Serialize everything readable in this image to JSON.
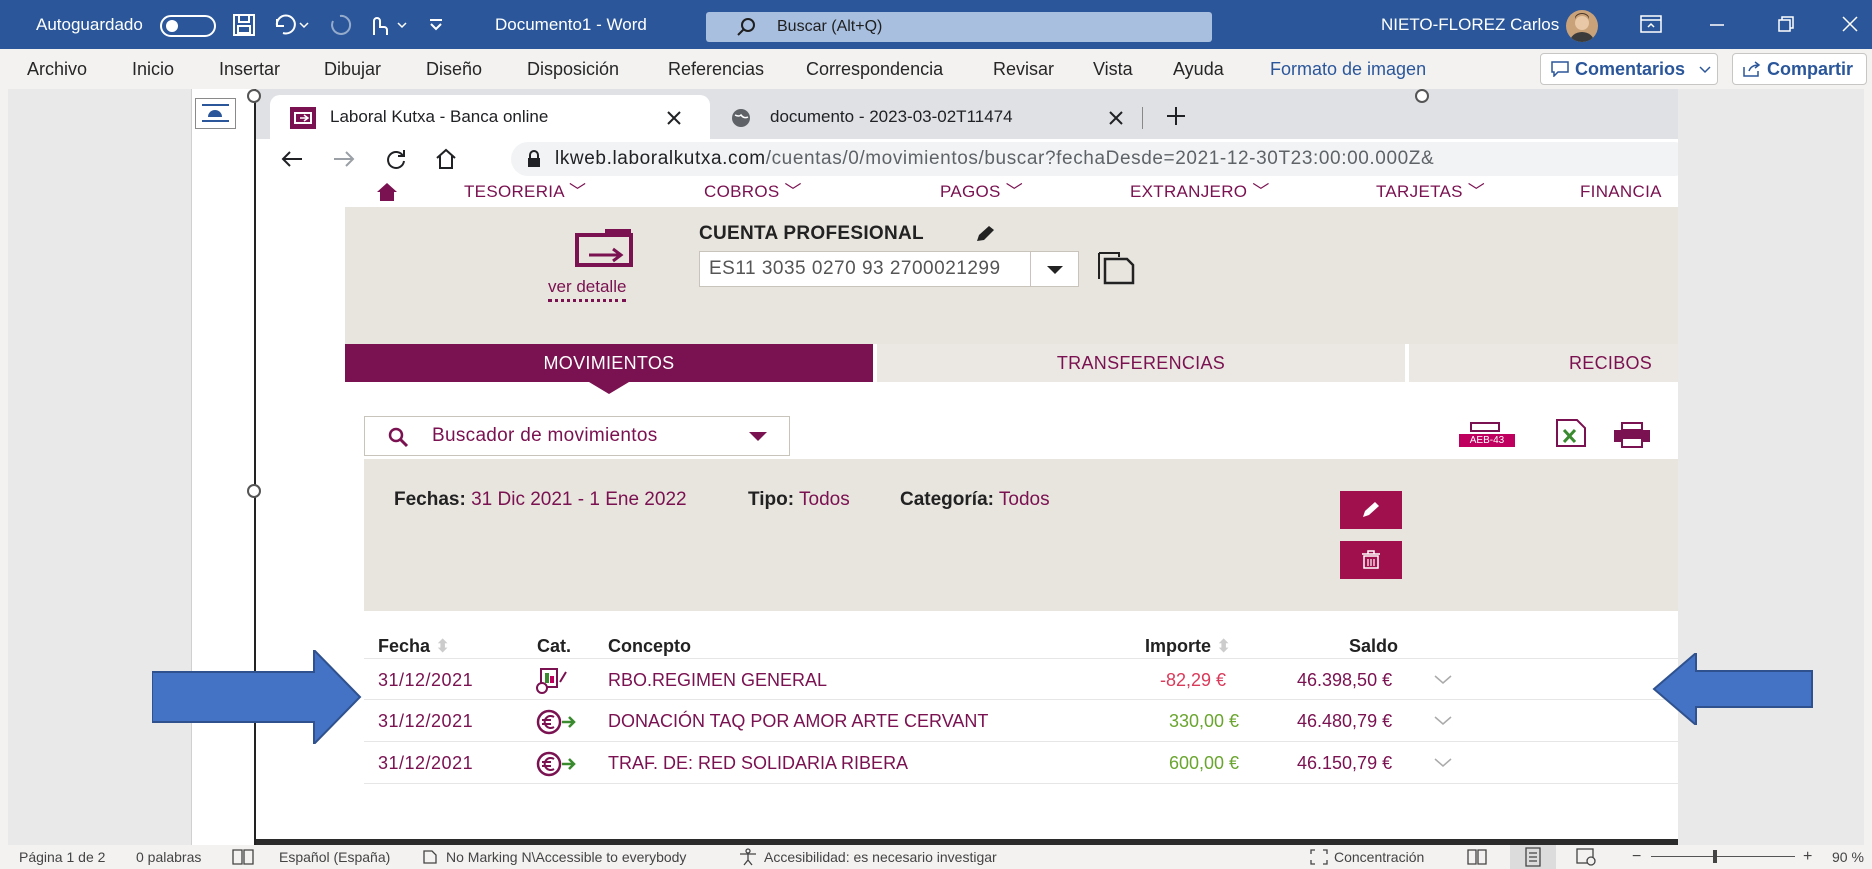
{
  "word": {
    "autosave_label": "Autoguardado",
    "doc_title": "Documento1  -  Word",
    "search_placeholder": "Buscar (Alt+Q)",
    "user_name": "NIETO-FLOREZ Carlos",
    "menu": [
      "Archivo",
      "Inicio",
      "Insertar",
      "Dibujar",
      "Diseño",
      "Disposición",
      "Referencias",
      "Correspondencia",
      "Revisar",
      "Vista",
      "Ayuda",
      "Formato de imagen"
    ],
    "comments_label": "Comentarios",
    "share_label": "Compartir",
    "accent": "#2b579a"
  },
  "browser": {
    "tab1": "Laboral Kutxa - Banca online",
    "tab2": "documento - 2023-03-02T11474",
    "url_domain": "lkweb.laboralkutxa.com",
    "url_path": "/cuentas/0/movimientos/buscar?fechaDesde=2021-12-30T23:00:00.000Z&"
  },
  "bank": {
    "brand_color": "#7a1150",
    "nav": [
      "TESORERIA",
      "COBROS",
      "PAGOS",
      "EXTRANJERO",
      "TARJETAS",
      "FINANCIA"
    ],
    "account_title": "CUENTA PROFESIONAL",
    "account_number": "ES11 3035 0270 93 2700021299",
    "ver_detalle": "ver detalle",
    "tabs": [
      "MOVIMIENTOS",
      "TRANSFERENCIAS",
      "RECIBOS"
    ],
    "search_label": "Buscador de movimientos",
    "aeb_label": "AEB-43",
    "filter": {
      "fechas_label": "Fechas:",
      "fechas_value": "31 Dic 2021 - 1 Ene 2022",
      "tipo_label": "Tipo:",
      "tipo_value": "Todos",
      "categoria_label": "Categoría:",
      "categoria_value": "Todos"
    },
    "table": {
      "headers": [
        "Fecha",
        "Cat.",
        "Concepto",
        "Importe",
        "Saldo"
      ],
      "rows": [
        {
          "fecha": "31/12/2021",
          "concepto": "RBO.REGIMEN GENERAL",
          "importe": "-82,29 €",
          "saldo": "46.398,50 €"
        },
        {
          "fecha": "31/12/2021",
          "concepto": "DONACIÓN TAQ POR AMOR ARTE CERVANT",
          "importe": "330,00 €",
          "saldo": "46.480,79 €"
        },
        {
          "fecha": "31/12/2021",
          "concepto": "TRAF. DE: RED SOLIDARIA RIBERA",
          "importe": "600,00 €",
          "saldo": "46.150,79 €"
        }
      ]
    }
  },
  "status": {
    "page": "Página 1 de 2",
    "words": "0 palabras",
    "language": "Español (España)",
    "marking": "No Marking N\\Accessible to everybody",
    "accessibility": "Accesibilidad: es necesario investigar",
    "focus": "Concentración",
    "zoom": "90 %"
  }
}
